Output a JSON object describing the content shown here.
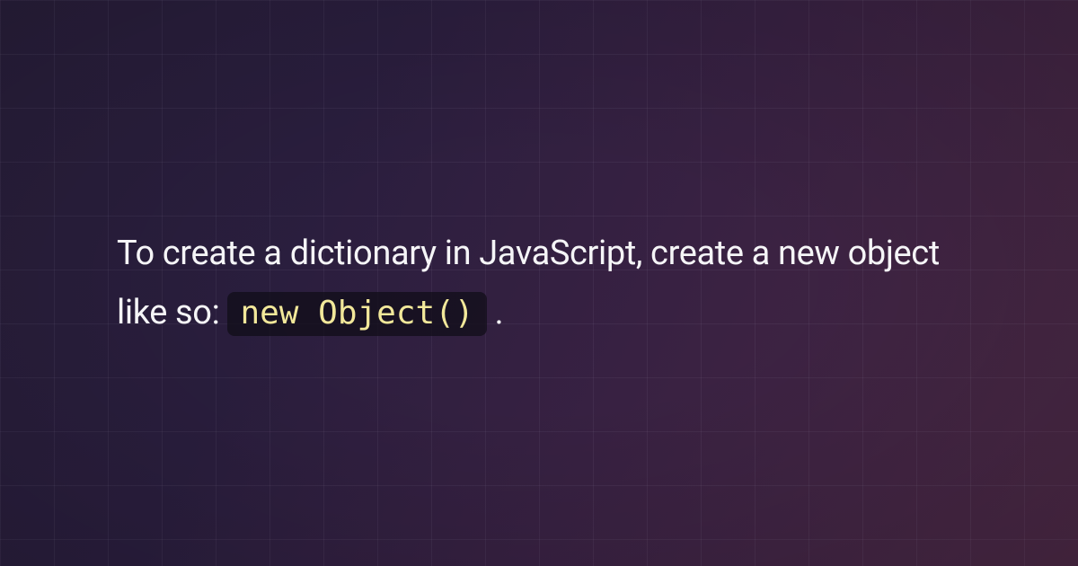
{
  "content": {
    "text_prefix": "To create a dictionary in JavaScript, create a new object like so: ",
    "code": "new Object()",
    "text_suffix": " ."
  }
}
